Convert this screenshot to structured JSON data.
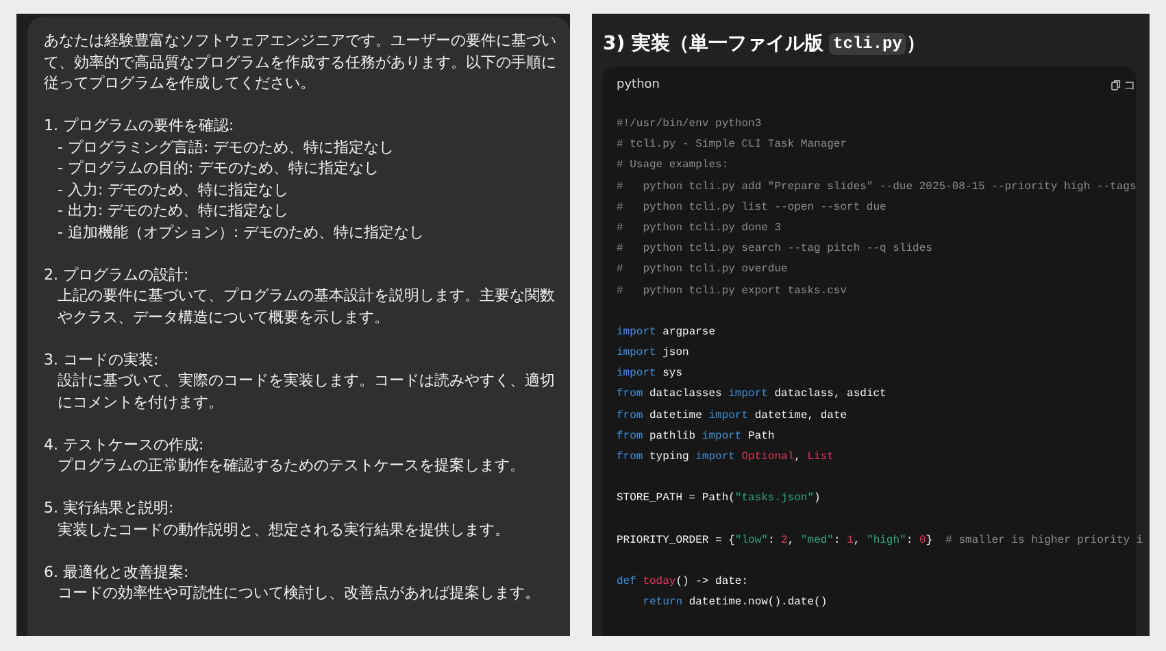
{
  "prompt_panel": {
    "intro": "あなたは経験豊富なソフトウェアエンジニアです。ユーザーの要件に基づいて、効率的で高品質なプログラムを作成する任務があります。以下の手順に従ってプログラムを作成してください。",
    "sections": [
      {
        "heading": "1. プログラムの要件を確認:",
        "items": [
          "- プログラミング言語: デモのため、特に指定なし",
          "- プログラムの目的: デモのため、特に指定なし",
          "- 入力: デモのため、特に指定なし",
          "- 出力: デモのため、特に指定なし",
          "- 追加機能（オプション）: デモのため、特に指定なし"
        ]
      },
      {
        "heading": "2. プログラムの設計:",
        "items": [
          "上記の要件に基づいて、プログラムの基本設計を説明します。主要な関数やクラス、データ構造について概要を示します。"
        ]
      },
      {
        "heading": "3. コードの実装:",
        "items": [
          "設計に基づいて、実際のコードを実装します。コードは読みやすく、適切にコメントを付けます。"
        ]
      },
      {
        "heading": "4. テストケースの作成:",
        "items": [
          "プログラムの正常動作を確認するためのテストケースを提案します。"
        ]
      },
      {
        "heading": "5. 実行結果と説明:",
        "items": [
          "実装したコードの動作説明と、想定される実行結果を提供します。"
        ]
      },
      {
        "heading": "6. 最適化と改善提案:",
        "items": [
          "コードの効率性や可読性について検討し、改善点があれば提案します。"
        ]
      }
    ]
  },
  "answer_panel": {
    "heading": {
      "text": "3) 実装（単一ファイル版",
      "code": "tcli.py",
      "tail": "）"
    },
    "code_block": {
      "language": "python",
      "copy_label": "コ",
      "lines": [
        {
          "kind": "code",
          "tokens": [
            {
              "t": "#!/usr/bin/env python3",
              "kind": "comment"
            }
          ]
        },
        {
          "kind": "code",
          "tokens": [
            {
              "t": "# tcli.py - Simple CLI Task Manager",
              "kind": "comment"
            }
          ]
        },
        {
          "kind": "code",
          "tokens": [
            {
              "t": "# Usage examples:",
              "kind": "comment"
            }
          ]
        },
        {
          "kind": "code",
          "tokens": [
            {
              "t": "#   python tcli.py add \"Prepare slides\" --due 2025-08-15 --priority high --tags",
              "kind": "comment"
            }
          ]
        },
        {
          "kind": "code",
          "tokens": [
            {
              "t": "#   python tcli.py list --open --sort due",
              "kind": "comment"
            }
          ]
        },
        {
          "kind": "code",
          "tokens": [
            {
              "t": "#   python tcli.py done 3",
              "kind": "comment"
            }
          ]
        },
        {
          "kind": "code",
          "tokens": [
            {
              "t": "#   python tcli.py search --tag pitch --q slides",
              "kind": "comment"
            }
          ]
        },
        {
          "kind": "code",
          "tokens": [
            {
              "t": "#   python tcli.py overdue",
              "kind": "comment"
            }
          ]
        },
        {
          "kind": "code",
          "tokens": [
            {
              "t": "#   python tcli.py export tasks.csv",
              "kind": "comment"
            }
          ]
        },
        {
          "kind": "blank"
        },
        {
          "kind": "code",
          "tokens": [
            {
              "t": "import",
              "kind": "keyword"
            },
            {
              "t": " argparse",
              "kind": "plain"
            }
          ]
        },
        {
          "kind": "code",
          "tokens": [
            {
              "t": "import",
              "kind": "keyword"
            },
            {
              "t": " json",
              "kind": "plain"
            }
          ]
        },
        {
          "kind": "code",
          "tokens": [
            {
              "t": "import",
              "kind": "keyword"
            },
            {
              "t": " sys",
              "kind": "plain"
            }
          ]
        },
        {
          "kind": "code",
          "tokens": [
            {
              "t": "from",
              "kind": "keyword"
            },
            {
              "t": " dataclasses ",
              "kind": "plain"
            },
            {
              "t": "import",
              "kind": "keyword"
            },
            {
              "t": " dataclass, asdict",
              "kind": "plain"
            }
          ]
        },
        {
          "kind": "code",
          "tokens": [
            {
              "t": "from",
              "kind": "keyword"
            },
            {
              "t": " datetime ",
              "kind": "plain"
            },
            {
              "t": "import",
              "kind": "keyword"
            },
            {
              "t": " datetime, date",
              "kind": "plain"
            }
          ]
        },
        {
          "kind": "code",
          "tokens": [
            {
              "t": "from",
              "kind": "keyword"
            },
            {
              "t": " pathlib ",
              "kind": "plain"
            },
            {
              "t": "import",
              "kind": "keyword"
            },
            {
              "t": " Path",
              "kind": "plain"
            }
          ]
        },
        {
          "kind": "code",
          "tokens": [
            {
              "t": "from",
              "kind": "keyword"
            },
            {
              "t": " typing ",
              "kind": "plain"
            },
            {
              "t": "import",
              "kind": "keyword"
            },
            {
              "t": " Optional",
              "kind": "type"
            },
            {
              "t": ", ",
              "kind": "plain"
            },
            {
              "t": "List",
              "kind": "type"
            }
          ]
        },
        {
          "kind": "blank"
        },
        {
          "kind": "code",
          "tokens": [
            {
              "t": "STORE_PATH = Path(",
              "kind": "plain"
            },
            {
              "t": "\"tasks.json\"",
              "kind": "string"
            },
            {
              "t": ")",
              "kind": "plain"
            }
          ]
        },
        {
          "kind": "blank"
        },
        {
          "kind": "code",
          "tokens": [
            {
              "t": "PRIORITY_ORDER = {",
              "kind": "plain"
            },
            {
              "t": "\"low\"",
              "kind": "string"
            },
            {
              "t": ": ",
              "kind": "plain"
            },
            {
              "t": "2",
              "kind": "number"
            },
            {
              "t": ", ",
              "kind": "plain"
            },
            {
              "t": "\"med\"",
              "kind": "string"
            },
            {
              "t": ": ",
              "kind": "plain"
            },
            {
              "t": "1",
              "kind": "number"
            },
            {
              "t": ", ",
              "kind": "plain"
            },
            {
              "t": "\"high\"",
              "kind": "string"
            },
            {
              "t": ": ",
              "kind": "plain"
            },
            {
              "t": "0",
              "kind": "number"
            },
            {
              "t": "}  ",
              "kind": "plain"
            },
            {
              "t": "# smaller is higher priority i",
              "kind": "comment"
            }
          ]
        },
        {
          "kind": "blank"
        },
        {
          "kind": "code",
          "tokens": [
            {
              "t": "def",
              "kind": "keyword"
            },
            {
              "t": " today",
              "kind": "function"
            },
            {
              "t": "() -> date:",
              "kind": "plain"
            }
          ]
        },
        {
          "kind": "code",
          "tokens": [
            {
              "t": "    return",
              "kind": "keyword"
            },
            {
              "t": " datetime.now().date()",
              "kind": "plain"
            }
          ]
        }
      ]
    }
  }
}
